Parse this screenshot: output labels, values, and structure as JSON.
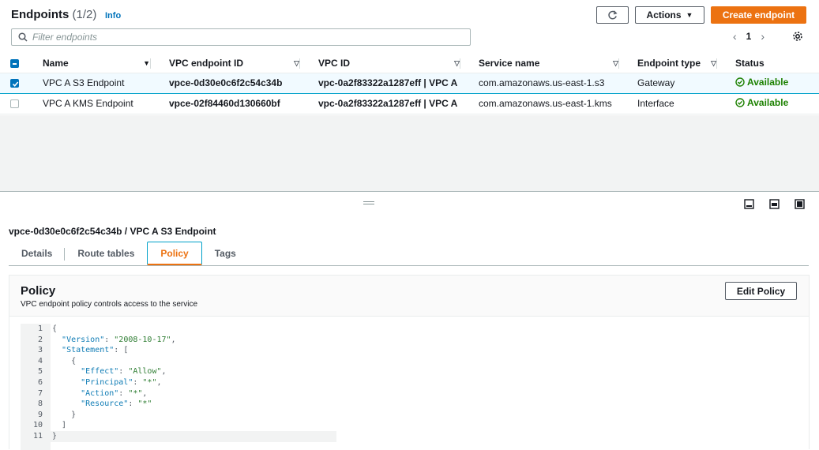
{
  "header": {
    "title": "Endpoints",
    "count": "(1/2)",
    "info": "Info",
    "actions_label": "Actions",
    "create_label": "Create endpoint"
  },
  "search": {
    "placeholder": "Filter endpoints"
  },
  "pagination": {
    "current_page": "1"
  },
  "table": {
    "columns": [
      "Name",
      "VPC endpoint ID",
      "VPC ID",
      "Service name",
      "Endpoint type",
      "Status"
    ],
    "rows": [
      {
        "name": "VPC A S3 Endpoint",
        "endpoint_id": "vpce-0d30e0c6f2c54c34b",
        "vpc_id": "vpc-0a2f83322a1287eff | VPC A",
        "service": "com.amazonaws.us-east-1.s3",
        "type": "Gateway",
        "status": "Available",
        "selected": true
      },
      {
        "name": "VPC A KMS Endpoint",
        "endpoint_id": "vpce-02f84460d130660bf",
        "vpc_id": "vpc-0a2f83322a1287eff | VPC A",
        "service": "com.amazonaws.us-east-1.kms",
        "type": "Interface",
        "status": "Available",
        "selected": false
      }
    ]
  },
  "detail": {
    "title": "vpce-0d30e0c6f2c54c34b / VPC A S3 Endpoint",
    "tabs": [
      "Details",
      "Route tables",
      "Policy",
      "Tags"
    ],
    "active_tab": "Policy"
  },
  "policy": {
    "title": "Policy",
    "description": "VPC endpoint policy controls access to the service",
    "edit_label": "Edit Policy",
    "code_lines": [
      "{",
      "  \"Version\": \"2008-10-17\",",
      "  \"Statement\": [",
      "    {",
      "      \"Effect\": \"Allow\",",
      "      \"Principal\": \"*\",",
      "      \"Action\": \"*\",",
      "      \"Resource\": \"*\"",
      "    }",
      "  ]",
      "}"
    ]
  },
  "colors": {
    "accent": "#ec7211",
    "link": "#0073bb",
    "success": "#1d8102"
  }
}
